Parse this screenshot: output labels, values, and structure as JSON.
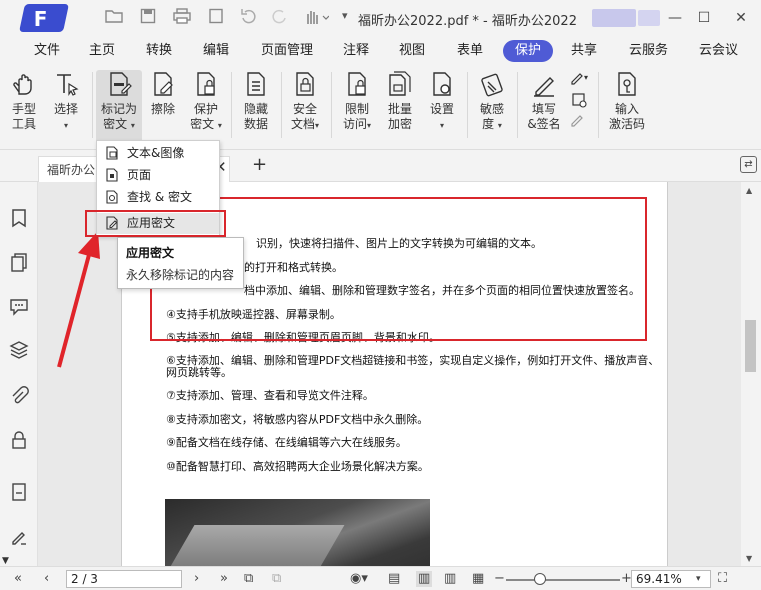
{
  "app": {
    "logo_letter": "F",
    "title": "福昕办公2022.pdf * - 福昕办公2022",
    "accent": "#4f5bd5"
  },
  "menubar": {
    "items": [
      "文件",
      "主页",
      "转换",
      "编辑",
      "页面管理",
      "注释",
      "视图",
      "表单",
      "保护",
      "共享",
      "云服务",
      "云会议"
    ],
    "active": "保护"
  },
  "ribbon": {
    "hand": "手型\n工具",
    "select": "选择",
    "mark_redact": "标记为\n密文",
    "erase": "擦除",
    "protect_redact": "保护\n密文",
    "hide_data": "隐藏\n数据",
    "secure_doc": "安全\n文档",
    "restrict_access": "限制\n访问",
    "batch_encrypt": "批量\n加密",
    "settings": "设置",
    "sensitivity": "敏感\n度",
    "fill_sign": "填写\n&签名",
    "enter_code": "输入\n激活码"
  },
  "tabs": {
    "doc_tab": "福昕办公",
    "close": "✕",
    "add": "+"
  },
  "dropdown": {
    "items": [
      "文本&图像",
      "页面",
      "查找 & 密文",
      "应用密文"
    ],
    "highlighted": "应用密文"
  },
  "tooltip": {
    "title": "应用密文",
    "desc": "永久移除标记的内容"
  },
  "document": {
    "lines": [
      "识别，快速将扫描件、图片上的文字转换为可编辑的文本。",
      "的打开和格式转换。",
      "档中添加、编辑、删除和管理数字签名，并在多个页面的相同位置快速放置签名。",
      "④支持手机放映遥控器、屏幕录制。",
      "⑤支持添加、编辑、删除和管理页眉页脚、背景和水印。",
      "⑥支持添加、编辑、删除和管理PDF文档超链接和书签，实现自定义操作，例如打开文件、播放声音、",
      "网页跳转等。",
      "⑦支持添加、管理、查看和导览文件注释。",
      "⑧支持添加密文，将敏感内容从PDF文档中永久删除。",
      "⑨配备文档在线存储、在线编辑等六大在线服务。",
      "⑩配备智慧打印、高效招聘两大企业场景化解决方案。"
    ]
  },
  "statusbar": {
    "page": "2 / 3",
    "zoom": "69.41%",
    "zoom_level": 0.3
  },
  "colors": {
    "highlight_red": "#d9262c",
    "arrow_red": "#e0242a"
  }
}
